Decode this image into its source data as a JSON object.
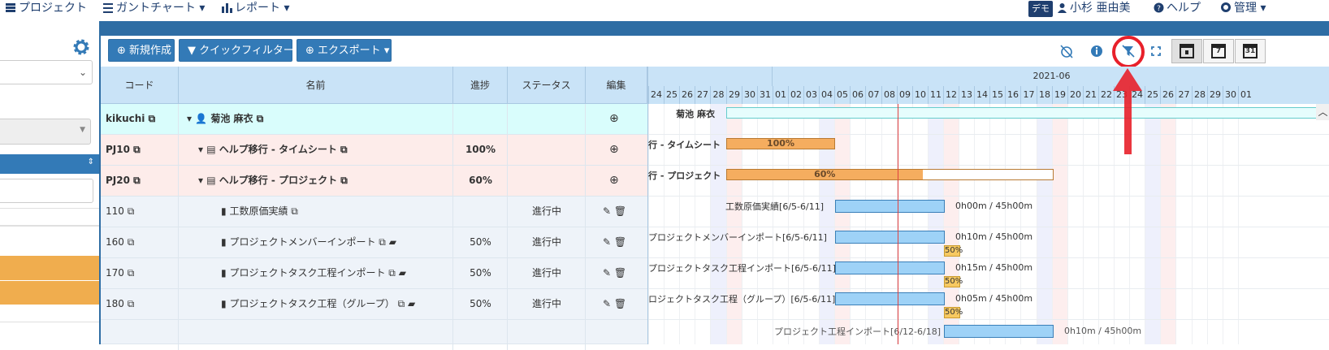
{
  "nav": {
    "project": "プロジェクト",
    "gantt": "ガントチャート",
    "report": "レポート",
    "demo_badge": "デモ",
    "user": "小杉 亜由美",
    "help": "ヘルプ",
    "admin": "管理"
  },
  "toolbar": {
    "new": "新規作成",
    "quick_filter": "クイックフィルター",
    "export": "エクスポート",
    "calendar_week": "7",
    "calendar_month": "31"
  },
  "grid": {
    "headers": {
      "code": "コード",
      "name": "名前",
      "progress": "進捗",
      "status": "ステータス",
      "edit": "編集"
    },
    "rows": [
      {
        "code": "kikuchi",
        "name": "菊池 麻衣",
        "progress": "",
        "status": ""
      },
      {
        "code": "PJ10",
        "name": "ヘルプ移行 - タイムシート",
        "progress": "100%",
        "status": ""
      },
      {
        "code": "PJ20",
        "name": "ヘルプ移行 - プロジェクト",
        "progress": "60%",
        "status": ""
      },
      {
        "code": "110",
        "name": "工数原価実績",
        "progress": "",
        "status": "進行中"
      },
      {
        "code": "160",
        "name": "プロジェクトメンバーインポート",
        "progress": "50%",
        "status": "進行中"
      },
      {
        "code": "170",
        "name": "プロジェクトタスク工程インポート",
        "progress": "50%",
        "status": "進行中"
      },
      {
        "code": "180",
        "name": "プロジェクトタスク工程（グループ）",
        "progress": "50%",
        "status": "進行中"
      }
    ]
  },
  "gantt": {
    "month_label": "2021-06",
    "days": [
      "24",
      "25",
      "26",
      "27",
      "28",
      "29",
      "30",
      "31",
      "01",
      "02",
      "03",
      "04",
      "05",
      "06",
      "07",
      "08",
      "09",
      "10",
      "11",
      "12",
      "13",
      "14",
      "15",
      "16",
      "17",
      "18",
      "19",
      "20",
      "21",
      "22",
      "23",
      "24",
      "25",
      "26",
      "27",
      "28",
      "29",
      "30",
      "01"
    ],
    "labels": [
      "菊池 麻衣",
      "行 - タイムシート",
      "行 - プロジェクト",
      "工数原価実績[6/5-6/11]",
      "プロジェクトメンバーインポート[6/5-6/11]",
      "プロジェクトタスク工程インポート[6/5-6/11]",
      "ロジェクトタスク工程（グループ）[6/5-6/11]"
    ],
    "bar_texts": [
      "100%",
      "60%"
    ],
    "time_texts": [
      "0h00m / 45h00m",
      "0h10m / 45h00m",
      "0h15m / 45h00m",
      "0h05m / 45h00m"
    ],
    "small_pct": [
      "50%",
      "50%",
      "50%"
    ],
    "partial_label": "プロジェクト工程インポート[6/12-6/18]",
    "partial_time": "0h10m / 45h00m"
  },
  "colors": {
    "primary": "#337ab7",
    "header": "#c9e3f7",
    "row_user": "#d9fdfc",
    "row_project": "#fdecea",
    "row_task": "#eef3f9",
    "bar_orange": "#f5ad5f",
    "bar_blue": "#9ed2f7",
    "today_line": "#e04040",
    "sidebar_orange": "#f0ad4e",
    "highlight": "#e8202a"
  }
}
